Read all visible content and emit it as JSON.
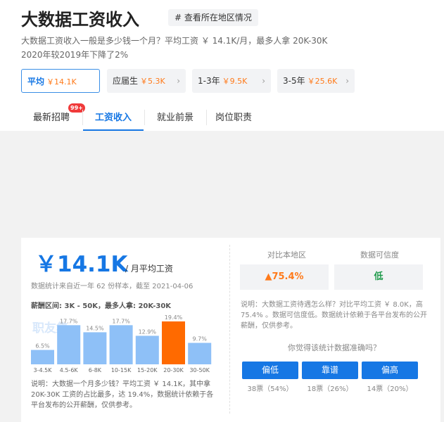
{
  "header": {
    "title": "大数据工资收入",
    "region_button": "# 查看所在地区情况",
    "summary_line1": "大数据工资收入一般是多少钱一个月？平均工资 ￥ 14.1K/月，最多人拿 20K-30K",
    "summary_line2": "2020年较2019年下降了2%"
  },
  "experience_tabs": [
    {
      "label": "平均",
      "value": "￥14.1K"
    },
    {
      "label": "应届生",
      "value": "￥5.3K"
    },
    {
      "label": "1-3年",
      "value": "￥9.5K"
    },
    {
      "label": "3-5年",
      "value": "￥25.6K"
    }
  ],
  "nav_tabs": [
    {
      "label": "最新招聘",
      "badge": "99+"
    },
    {
      "label": "工资收入"
    },
    {
      "label": "就业前景"
    },
    {
      "label": "岗位职责"
    }
  ],
  "salary_card": {
    "avg_value": "￥14.1K",
    "avg_unit": "/ 月平均工资",
    "stats_note": "数据统计来自近一年 62 份样本，截至 2021-04-06",
    "range_label": "薪酬区间: 3K - 50K，最多人拿: 20K-30K",
    "watermark": "职友集",
    "chart_note": "说明：大数据一个月多少钱？平均工资 ￥ 14.1K，其中拿 20K-30K 工资的占比最多，达 19.4%，数据统计依赖于各平台发布的公开薪酬，仅供参考。"
  },
  "chart_data": {
    "type": "bar",
    "categories": [
      "3-4.5K",
      "4.5-6K",
      "6-8K",
      "10-15K",
      "15-20K",
      "20-30K",
      "30-50K"
    ],
    "values": [
      6.5,
      17.7,
      14.5,
      17.7,
      12.9,
      19.4,
      9.7
    ],
    "value_labels": [
      "6.5%",
      "17.7%",
      "14.5%",
      "17.7%",
      "12.9%",
      "19.4%",
      "9.7%"
    ],
    "highlight_index": 5,
    "colors": {
      "bar": "#8ec0f7",
      "highlight": "#ff6a00"
    }
  },
  "comparison": {
    "local_title": "对比本地区",
    "local_value": "75.4%",
    "trust_title": "数据可信度",
    "trust_value": "低",
    "note": "说明：大数据工资待遇怎么样？对比平均工资 ￥ 8.0K，高 75.4% 。数据可信度低。数据统计依赖于各平台发布的公开薪酬，仅供参考。",
    "poll_question": "你觉得该统计数据准确吗？",
    "votes": [
      {
        "label": "偏低",
        "count": "38票（54%）"
      },
      {
        "label": "靠谱",
        "count": "18票（26%）"
      },
      {
        "label": "偏高",
        "count": "14票（20%）"
      }
    ]
  },
  "colors": {
    "accent": "#1677e4",
    "orange": "#ff7a1a",
    "green": "#1e9a4a"
  }
}
